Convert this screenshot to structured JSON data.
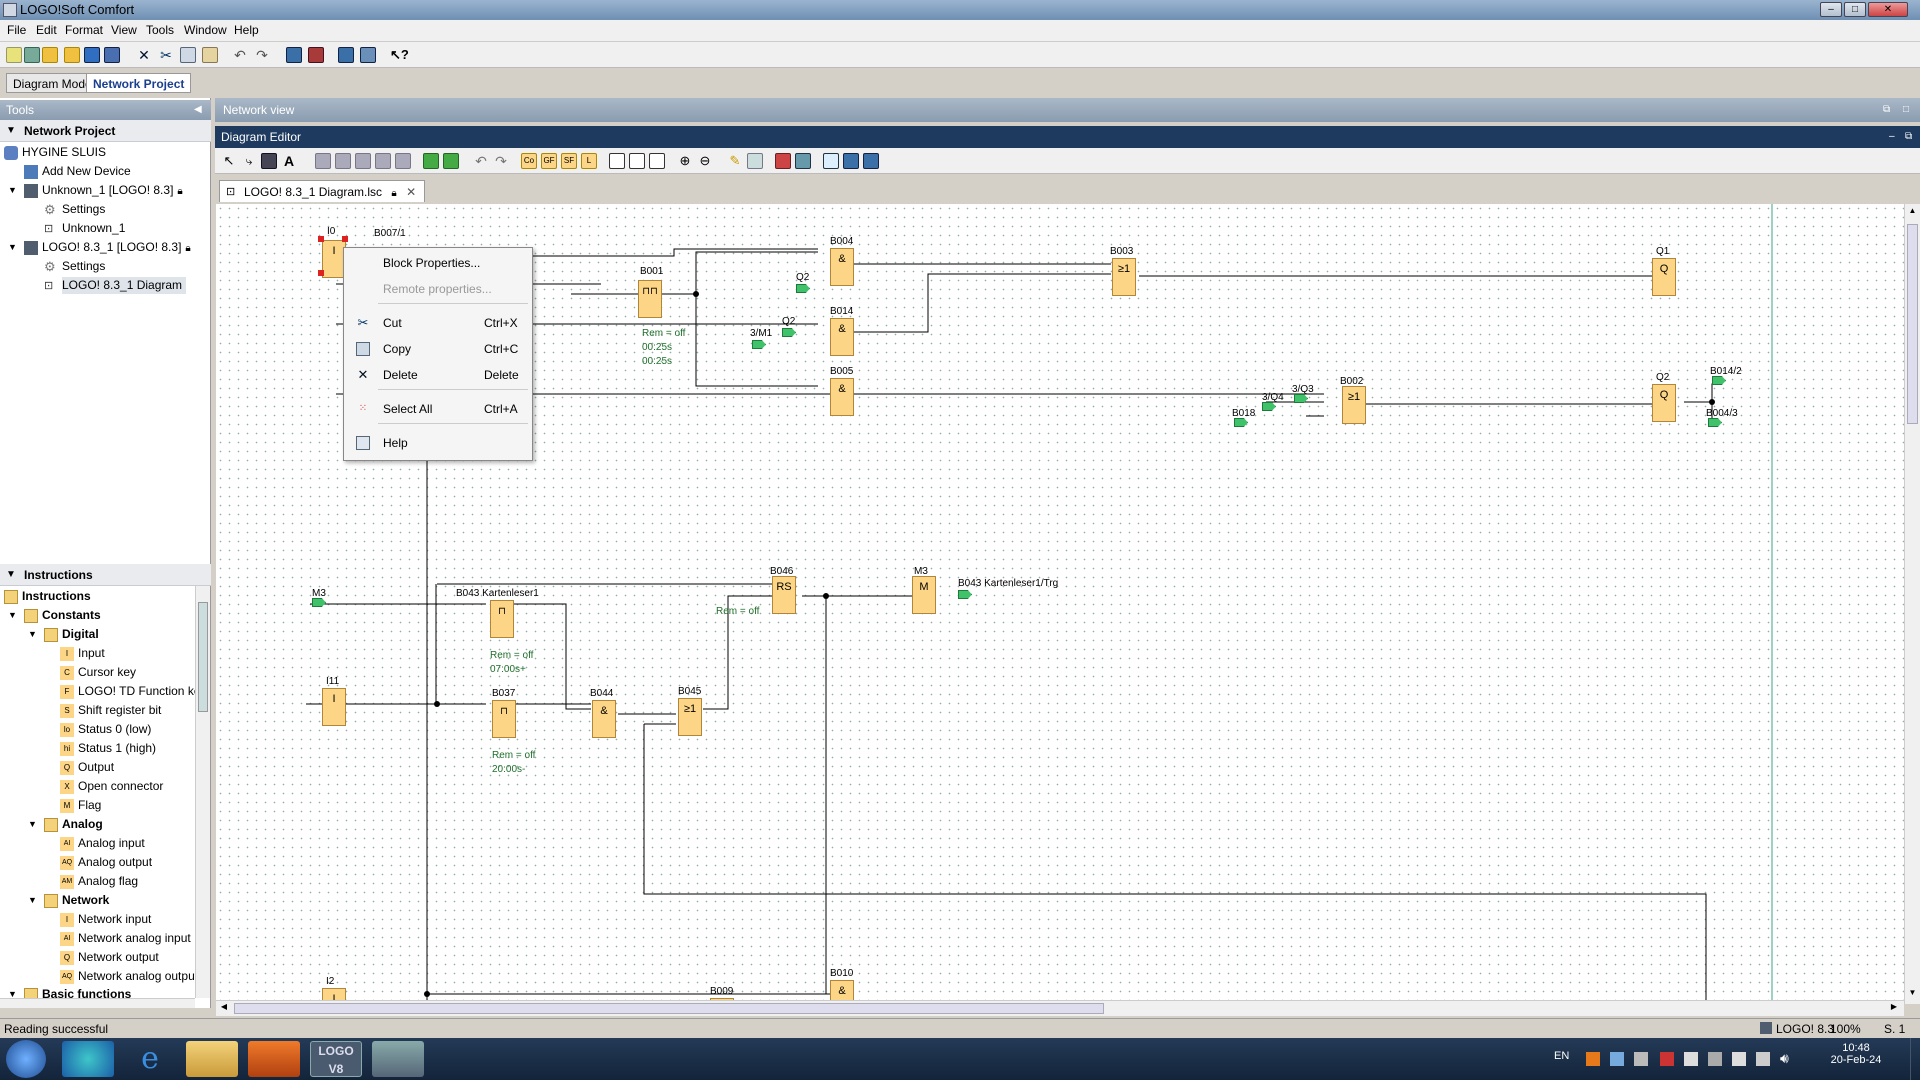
{
  "window": {
    "title": "LOGO!Soft Comfort"
  },
  "menubar": {
    "items": [
      "File",
      "Edit",
      "Format",
      "View",
      "Tools",
      "Window",
      "Help"
    ]
  },
  "mode_tabs": [
    "Diagram Mode",
    "Network Project"
  ],
  "tools_panel": {
    "title": "Tools"
  },
  "network_project": {
    "header": "Network Project",
    "items": [
      "HYGINE SLUIS",
      "Add New Device",
      "Unknown_1 [LOGO! 8.3]",
      "Settings",
      "Unknown_1",
      "LOGO! 8.3_1 [LOGO! 8.3]",
      "Settings",
      "LOGO! 8.3_1 Diagram"
    ]
  },
  "instructions": {
    "header": "Instructions",
    "items": [
      "Instructions",
      "Constants",
      "Digital",
      "Input",
      "Cursor key",
      "LOGO! TD Function key",
      "Shift register bit",
      "Status 0 (low)",
      "Status 1 (high)",
      "Output",
      "Open connector",
      "Flag",
      "Analog",
      "Analog input",
      "Analog output",
      "Analog flag",
      "Network",
      "Network input",
      "Network analog input",
      "Network output",
      "Network analog output",
      "Basic functions"
    ],
    "icons": [
      "I",
      "C",
      "F",
      "S",
      "lo",
      "hi",
      "Q",
      "X",
      "M",
      "AI",
      "AQ",
      "AM",
      "I",
      "AI",
      "Q",
      "AQ"
    ]
  },
  "network_view": {
    "title": "Network view"
  },
  "diagram_editor": {
    "title": "Diagram Editor",
    "tab": "LOGO! 8.3_1 Diagram.lsc"
  },
  "blocks": {
    "I0": "I0",
    "B007_1": "B007/1",
    "B001": "B001",
    "B001_rem": "Rem = off",
    "B001_t1": "00:25s",
    "B001_t2": "00:25s",
    "B004": "B004",
    "Q2a": "Q2",
    "B014": "B014",
    "Q2b": "Q2",
    "M1": "3/M1",
    "B005": "B005",
    "B003": "B003",
    "Q1": "Q1",
    "Q2": "Q2",
    "B014_2": "B014/2",
    "B004_3": "B004/3",
    "B002": "B002",
    "Q3": "3/Q3",
    "Q4": "3/Q4",
    "B018": "B018",
    "M3a": "M3",
    "B043": "B043 Kartenleser1",
    "B043_rem": "Rem = off",
    "B043_t": "07:00s+",
    "B046": "B046",
    "B046_rem": "Rem = off",
    "M3": "M3",
    "B043trg": "B043 Kartenleser1/Trg",
    "I11": "I11",
    "B037": "B037",
    "B037_rem": "Rem = off",
    "B037_t": "20:00s-",
    "B044": "B044",
    "B045": "B045",
    "I2": "I2",
    "B009": "B009",
    "B010": "B010",
    "sym_and": "&",
    "sym_or": "≥1",
    "sym_rs": "RS",
    "sym_m": "M",
    "sym_q": "Q",
    "sym_i": "I"
  },
  "context_menu": [
    {
      "label": "Block Properties...",
      "shortcut": "",
      "icon": "",
      "enabled": true
    },
    {
      "label": "Remote properties...",
      "shortcut": "",
      "icon": "",
      "enabled": false
    },
    {
      "label": "Cut",
      "shortcut": "Ctrl+X",
      "icon": "cut-icon",
      "enabled": true
    },
    {
      "label": "Copy",
      "shortcut": "Ctrl+C",
      "icon": "copy-icon",
      "enabled": true
    },
    {
      "label": "Delete",
      "shortcut": "Delete",
      "icon": "delete-icon",
      "enabled": true
    },
    {
      "label": "Select All",
      "shortcut": "Ctrl+A",
      "icon": "select-all-icon",
      "enabled": true
    },
    {
      "label": "Help",
      "shortcut": "",
      "icon": "help-icon",
      "enabled": true
    }
  ],
  "statusbar": {
    "left": "Reading successful",
    "device": "LOGO! 8.3",
    "zoom": "100%",
    "page": "S. 1"
  },
  "taskbar": {
    "lang": "EN",
    "time": "10:48",
    "date": "20-Feb-24",
    "logo_app": "LOGO V8"
  }
}
